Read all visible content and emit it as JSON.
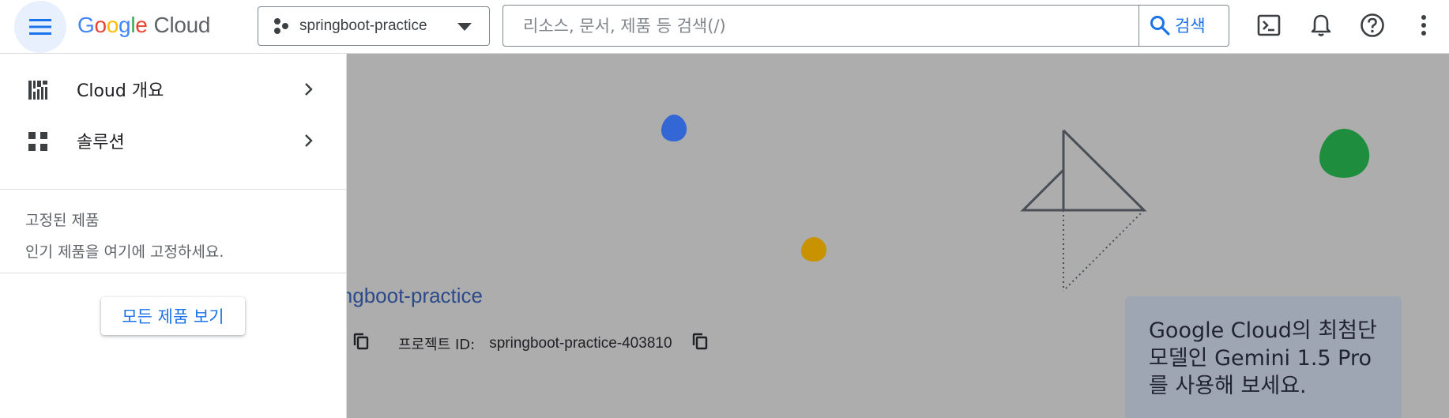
{
  "header": {
    "logo": {
      "g1": "G",
      "o1": "o",
      "o2": "o",
      "g2": "g",
      "l": "l",
      "e": "e",
      "product": "Cloud"
    },
    "project_picker": {
      "name": "springboot-practice"
    },
    "search": {
      "placeholder": "리소스, 문서, 제품 등 검색(/)",
      "button_label": "검색"
    }
  },
  "drawer": {
    "items": [
      {
        "label": "Cloud 개요"
      },
      {
        "label": "솔루션"
      }
    ],
    "pinned": {
      "title": "고정된 제품",
      "empty_text": "인기 제품을 여기에 고정하세요."
    },
    "all_products_label": "모든 제품 보기"
  },
  "main": {
    "project_title": "ingboot-practice",
    "project_id_label": "프로젝트 ID:",
    "project_id_value": "springboot-practice-403810",
    "promo_text": "Google Cloud의 최첨단 모델인 Gemini 1.5 Pro를 사용해 보세요."
  },
  "colors": {
    "accent": "#1a73e8",
    "menu_highlight": "#e8f0fe",
    "overlay_bg": "#adadad",
    "blob_blue": "#3367d6",
    "blob_yellow": "#c99200",
    "blob_green": "#1e8e3e"
  }
}
